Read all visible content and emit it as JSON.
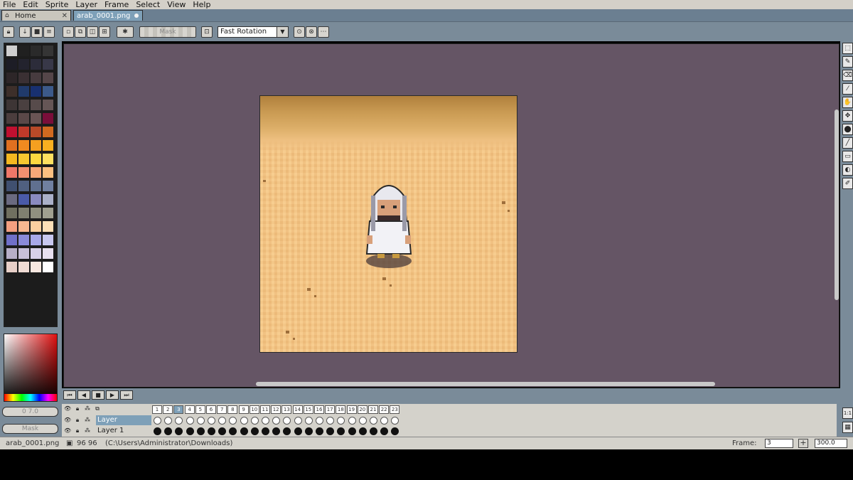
{
  "menu": [
    "File",
    "Edit",
    "Sprite",
    "Layer",
    "Frame",
    "Select",
    "View",
    "Help"
  ],
  "tabs": {
    "home": "Home",
    "doc": "arab_0001.png"
  },
  "toolbar": {
    "mask_label": "Mask",
    "rotation_mode": "Fast Rotation"
  },
  "left_panel": {
    "opacity_label": "0 7.0",
    "mask_label": "Mask"
  },
  "palette_colors": [
    "#cfcfcf",
    "#202020",
    "#2a2a2a",
    "#353535",
    "#1d1d26",
    "#23232e",
    "#2c2c3a",
    "#383848",
    "#2d2628",
    "#3a3033",
    "#473b3f",
    "#554649",
    "#3d2f2a",
    "#203a6a",
    "#183070",
    "#3c5a8a",
    "#3d3535",
    "#4a4040",
    "#574b4b",
    "#655656",
    "#4b3d3d",
    "#5a4848",
    "#6a5454",
    "#7a0e3a",
    "#c01030",
    "#c03a2a",
    "#b84a28",
    "#d06a20",
    "#e07020",
    "#f08a20",
    "#f4a020",
    "#f8b020",
    "#f4b820",
    "#f8c830",
    "#fcd840",
    "#fde060",
    "#f07868",
    "#f49070",
    "#f8a878",
    "#fcc080",
    "#405070",
    "#506080",
    "#607090",
    "#7080a0",
    "#6a6a80",
    "#4a5aa8",
    "#8a8ac0",
    "#aab0c8",
    "#707060",
    "#808070",
    "#909080",
    "#a0a090",
    "#f4a080",
    "#f8b890",
    "#fcd0a0",
    "#fde0b8",
    "#7070c8",
    "#8a8ad8",
    "#a8a8e8",
    "#c8c8f0",
    "#b8b0c8",
    "#c8c0d8",
    "#d8d0e8",
    "#e8e0f0",
    "#e8d0c8",
    "#f0dcd4",
    "#f8e8e0",
    "#ffffff"
  ],
  "timeline": {
    "frame_numbers": [
      "1",
      "2",
      "3",
      "4",
      "5",
      "6",
      "7",
      "8",
      "9",
      "10",
      "11",
      "12",
      "13",
      "14",
      "15",
      "16",
      "17",
      "18",
      "19",
      "20",
      "21",
      "22",
      "23"
    ],
    "current_frame_index": 2,
    "layers": [
      {
        "name": "Layer",
        "cels": "empty"
      },
      {
        "name": "Layer 1",
        "cels": "full"
      }
    ]
  },
  "status": {
    "filename": "arab_0001.png",
    "size": "96 96",
    "path": "(C:\\Users\\Administrator\\Downloads)",
    "frame_label": "Frame:",
    "frame_value": "3",
    "zoom": "300.0"
  },
  "icons": {
    "tab_home": "house-icon",
    "right_tools": [
      "marquee-icon",
      "pencil-icon",
      "eraser-icon",
      "eyedropper-icon",
      "hand-icon",
      "move-icon",
      "bucket-icon",
      "line-icon",
      "rectangle-icon",
      "ellipse-icon",
      "brush-icon"
    ]
  }
}
